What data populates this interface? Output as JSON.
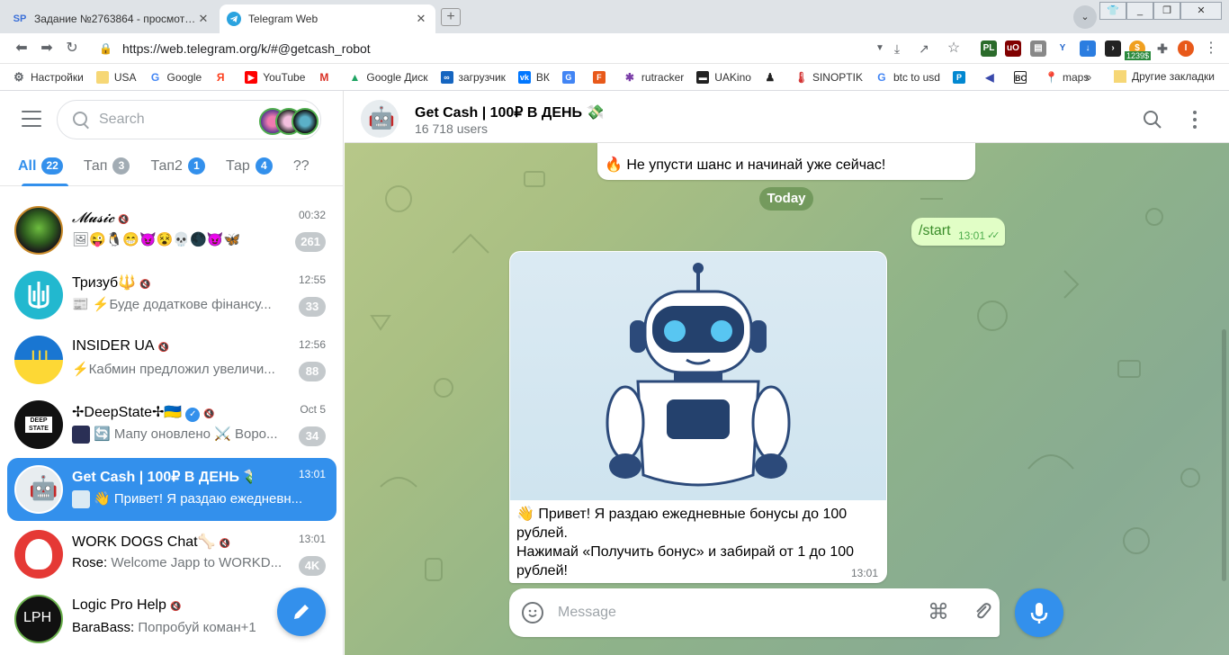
{
  "browser": {
    "tabs": [
      {
        "title": "Задание №2763864 - просмотр за...",
        "favicon": "SP",
        "active": false
      },
      {
        "title": "Telegram Web",
        "favicon": "telegram-icon",
        "active": true
      }
    ],
    "url": "https://web.telegram.org/k/#@getcash_robot",
    "extension_badge": "1239$",
    "bookmarks": [
      {
        "label": "Настройки",
        "icon": "gear-icon"
      },
      {
        "label": "USA",
        "icon": "folder-icon"
      },
      {
        "label": "Google",
        "icon": "google-icon"
      },
      {
        "label": "",
        "icon": "yandex-icon"
      },
      {
        "label": "YouTube",
        "icon": "youtube-icon"
      },
      {
        "label": "",
        "icon": "gmail-icon"
      },
      {
        "label": "Google Диск",
        "icon": "drive-icon"
      },
      {
        "label": "загрузчик",
        "icon": "loader-icon"
      },
      {
        "label": "ВК",
        "icon": "vk-icon"
      },
      {
        "label": "",
        "icon": "translate-icon"
      },
      {
        "label": "",
        "icon": "f-icon"
      },
      {
        "label": "rutracker",
        "icon": "rutracker-icon"
      },
      {
        "label": "UAKino",
        "icon": "uakino-icon"
      },
      {
        "label": "",
        "icon": "person-icon"
      },
      {
        "label": "SINOPTIK",
        "icon": "thermometer-icon"
      },
      {
        "label": "btc to usd",
        "icon": "google-icon"
      },
      {
        "label": "",
        "icon": "p-icon"
      },
      {
        "label": "",
        "icon": "arrow-icon"
      },
      {
        "label": "",
        "icon": "bc-icon"
      },
      {
        "label": "maps",
        "icon": "maps-icon"
      }
    ],
    "bookmarks_more": "»",
    "other_bookmarks": "Другие закладки"
  },
  "sidebar": {
    "search_placeholder": "Search",
    "folders": [
      {
        "label": "All",
        "count": "22",
        "active": true
      },
      {
        "label": "Тап",
        "count": "3",
        "active": false
      },
      {
        "label": "Тап2",
        "count": "1",
        "active": false
      },
      {
        "label": "Тар",
        "count": "4",
        "active": false
      },
      {
        "label": "??",
        "count": "",
        "active": false
      }
    ],
    "chats": [
      {
        "name": "𝓜𝓾𝓼𝓲𝓬",
        "muted": true,
        "time": "00:32",
        "message": "🖼😜🐧😁😈😵💀🌑😈🦋",
        "sender": "",
        "unread": "261",
        "avatar": "alien"
      },
      {
        "name": "Тризуб🔱",
        "muted": true,
        "time": "12:55",
        "message": "⚡Буде додаткове фінансу...",
        "sender": "",
        "unread": "33",
        "avatar": "trident"
      },
      {
        "name": "INSIDER UA",
        "muted": true,
        "time": "12:56",
        "message": "⚡Кабмин предложил увеличи...",
        "sender": "",
        "unread": "88",
        "avatar": "ua-flag"
      },
      {
        "name": "✢DeepState✢🇺🇦",
        "muted": true,
        "time": "Oct 5",
        "message": "🔄 Мапу оновлено ⚔️ Воро...",
        "sender": "",
        "unread": "34",
        "avatar": "deepstate"
      },
      {
        "name": "Get Cash | 100₽ В ДЕНЬ 💸",
        "muted": false,
        "time": "13:01",
        "message": "👋 Привет! Я раздаю ежедневн...",
        "sender": "",
        "unread": "",
        "avatar": "robot",
        "active": true
      },
      {
        "name": "WORK DOGS Chat🦴",
        "muted": true,
        "time": "13:01",
        "message": "Welcome Japp to WORKD...",
        "sender": "Rose: ",
        "unread": "4K",
        "avatar": "dog"
      },
      {
        "name": "Logic Pro Help",
        "muted": true,
        "time": "",
        "message": "Попробуй коман+1",
        "sender": "BaraBass: ",
        "unread": "",
        "avatar": "lph"
      }
    ]
  },
  "chat": {
    "title": "Get Cash | 100₽ В ДЕНЬ 💸",
    "subtitle": "16 718 users",
    "prev_message": "🔥 Не упусти шанс и начинай уже сейчас!",
    "date_separator": "Today",
    "outgoing_text": "/start",
    "outgoing_time": "13:01",
    "bot_text_1": "👋 Привет! Я раздаю ежедневные бонусы до 100 рублей.",
    "bot_text_2": "Нажимай «Получить бонус» и забирай от 1 до 100 рублей!",
    "bot_time": "13:01",
    "input_placeholder": "Message"
  },
  "colors": {
    "accent": "#3390ec",
    "outgoing": "#e1fec6",
    "read_check": "#4fae4e"
  }
}
